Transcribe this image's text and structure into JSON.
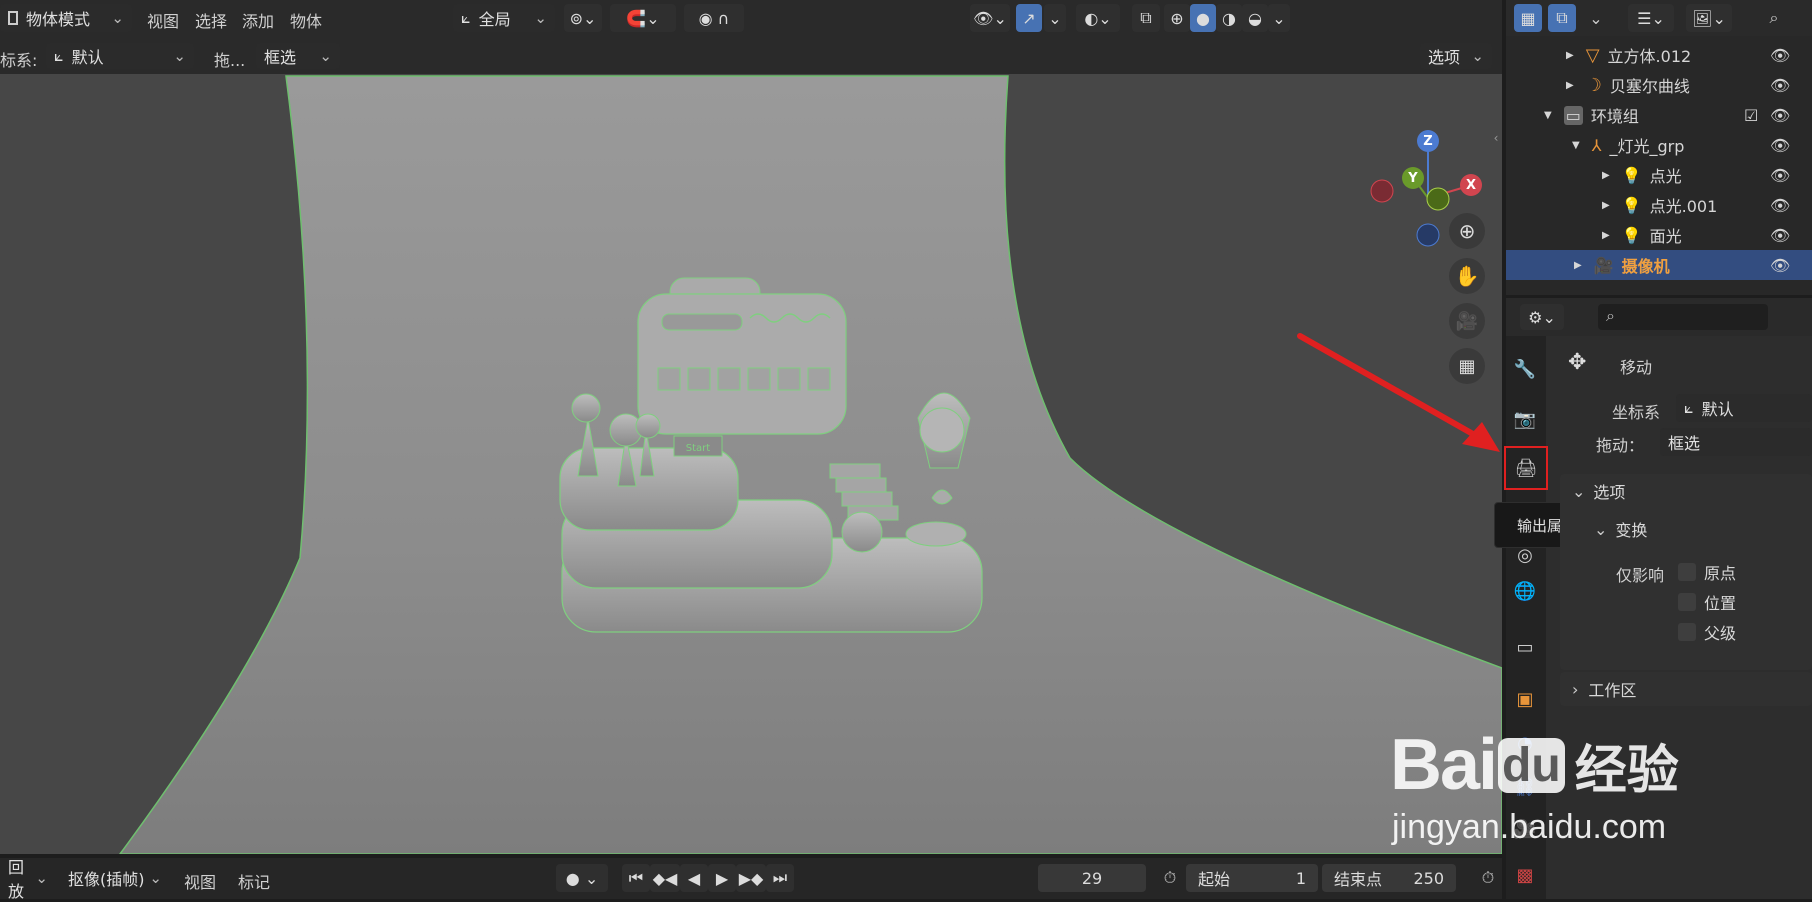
{
  "header": {
    "mode_label": "物体模式",
    "menu": [
      "视图",
      "选择",
      "添加",
      "物体"
    ],
    "transform_orientation": "全局",
    "options_label": "选项"
  },
  "tool_settings": {
    "coord_label": "标系:",
    "coord_value": "默认",
    "drag_label": "拖...",
    "drag_value": "框选"
  },
  "gizmo": {
    "z": "Z",
    "y": "Y",
    "x": "X"
  },
  "scene_sign": "Start",
  "outliner": {
    "items": [
      {
        "label": "立方体.012",
        "icon": "mesh-icon"
      },
      {
        "label": "贝塞尔曲线",
        "icon": "curve-icon"
      },
      {
        "label": "环境组",
        "icon": "collection-icon"
      },
      {
        "label": "_灯光_grp",
        "icon": "empty-icon"
      },
      {
        "label": "点光",
        "icon": "light-icon"
      },
      {
        "label": "点光.001",
        "icon": "light-icon"
      },
      {
        "label": "面光",
        "icon": "light-icon"
      },
      {
        "label": "摄像机",
        "icon": "camera-icon"
      }
    ]
  },
  "properties": {
    "tool_name": "移动",
    "coord_label": "坐标系",
    "coord_value": "默认",
    "drag_label": "拖动：",
    "drag_value": "框选",
    "options_panel": "选项",
    "transform_label": "变换",
    "affect_only_label": "仅影响",
    "affect_items": [
      "原点",
      "位置",
      "父级"
    ],
    "workspace_panel": "工作区",
    "tooltip": "输出属性"
  },
  "timeline": {
    "playback_label": "回放",
    "keying_label": "抠像(插帧)",
    "view_label": "视图",
    "marker_label": "标记",
    "current_frame": "29",
    "start_label": "起始",
    "start_value": "1",
    "end_label": "结束点",
    "end_value": "250"
  },
  "watermark": {
    "brand": "Bai",
    "brand_du": "du",
    "cn": "经验",
    "url": "jingyan.baidu.com"
  },
  "colors": {
    "accent_blue": "#4772b3",
    "highlight_red": "#e02020",
    "selected_row": "#334d80",
    "object_outline": "#6fbf6f"
  }
}
